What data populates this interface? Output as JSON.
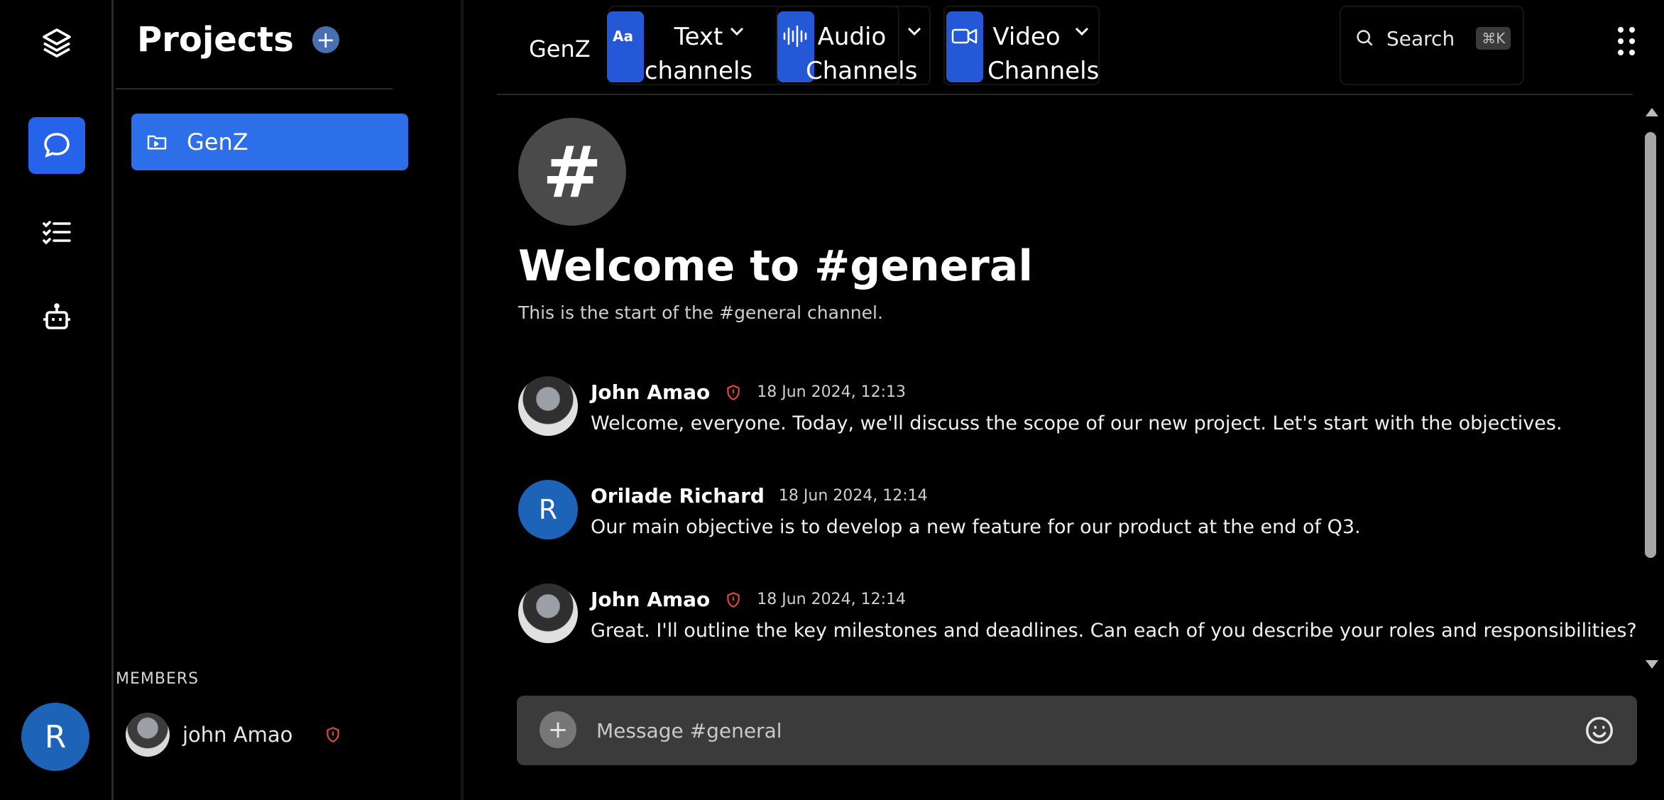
{
  "rail": {
    "items": [
      {
        "icon": "layers-icon"
      },
      {
        "icon": "chat-bubble-icon",
        "active": true
      },
      {
        "icon": "checklist-icon"
      },
      {
        "icon": "bot-icon"
      }
    ],
    "user_initial": "R"
  },
  "projects": {
    "title": "Projects",
    "items": [
      {
        "label": "GenZ",
        "active": true
      }
    ],
    "members_label": "MEMBERS",
    "members": [
      {
        "name": "john Amao"
      }
    ]
  },
  "topbar": {
    "server_name": "GenZ",
    "channel_groups": [
      {
        "label": "Text\nchannels",
        "icon": "text-aa-icon"
      },
      {
        "label": "Audio\nChannels",
        "icon": "audio-wave-icon"
      },
      {
        "label": "Video\nChannels",
        "icon": "video-camera-icon"
      }
    ],
    "search": {
      "label": "Search",
      "shortcut": "⌘K"
    }
  },
  "channel": {
    "title": "Welcome to #general",
    "subtitle": "This is the start of the #general channel."
  },
  "messages": [
    {
      "author": "John Amao",
      "time": "18 Jun 2024, 12:13",
      "text": "Welcome, everyone. Today, we'll discuss the scope of our new project. Let's start with the objectives.",
      "admin": true
    },
    {
      "author": "Orilade Richard",
      "initial": "R",
      "time": "18 Jun 2024, 12:14",
      "text": "Our main objective is to develop a new feature for our product at the end of Q3.",
      "admin": false
    },
    {
      "author": "John Amao",
      "time": "18 Jun 2024, 12:14",
      "text": "Great. I'll outline the key milestones and deadlines. Can each of you describe your roles and responsibilities?",
      "admin": true
    }
  ],
  "composer": {
    "placeholder": "Message #general"
  },
  "colors": {
    "accent": "#2d6fe8",
    "avatar_blue": "#1d64b8",
    "admin_shield": "#e0483d"
  }
}
